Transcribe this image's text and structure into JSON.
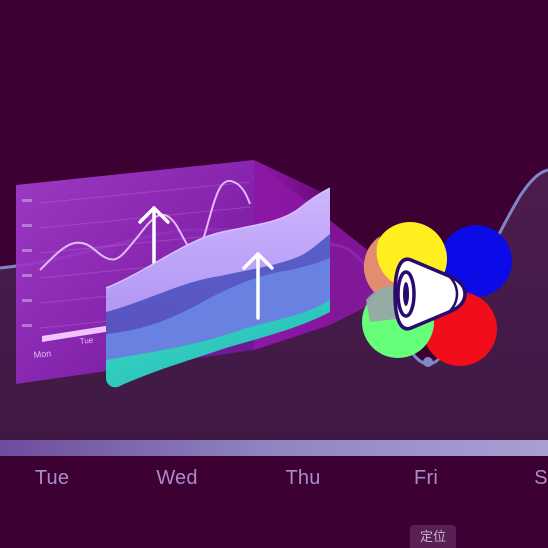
{
  "background_chart": {
    "day_labels": [
      "Tue",
      "Wed",
      "Thu",
      "Fri",
      "S"
    ]
  },
  "panel_chart": {
    "x_labels": [
      "Mon",
      "Tue"
    ]
  },
  "badge": {
    "label": "定位"
  },
  "icons": [
    "up-arrow-icon",
    "rgb-color-wheel-icon",
    "speaker-icon"
  ],
  "colors": {
    "background": "#3c0032",
    "timeline_bar": "#8a7fb7",
    "panel_purple": "#9c2bc2",
    "panel_lavender": "#bba6f5",
    "panel_blue": "#6272d9",
    "panel_teal": "#2fd3c8",
    "wheel_yellow": "#ffef1f",
    "wheel_blue": "#0b0be8",
    "wheel_red": "#f20d1a",
    "wheel_green": "#66ff7a"
  }
}
